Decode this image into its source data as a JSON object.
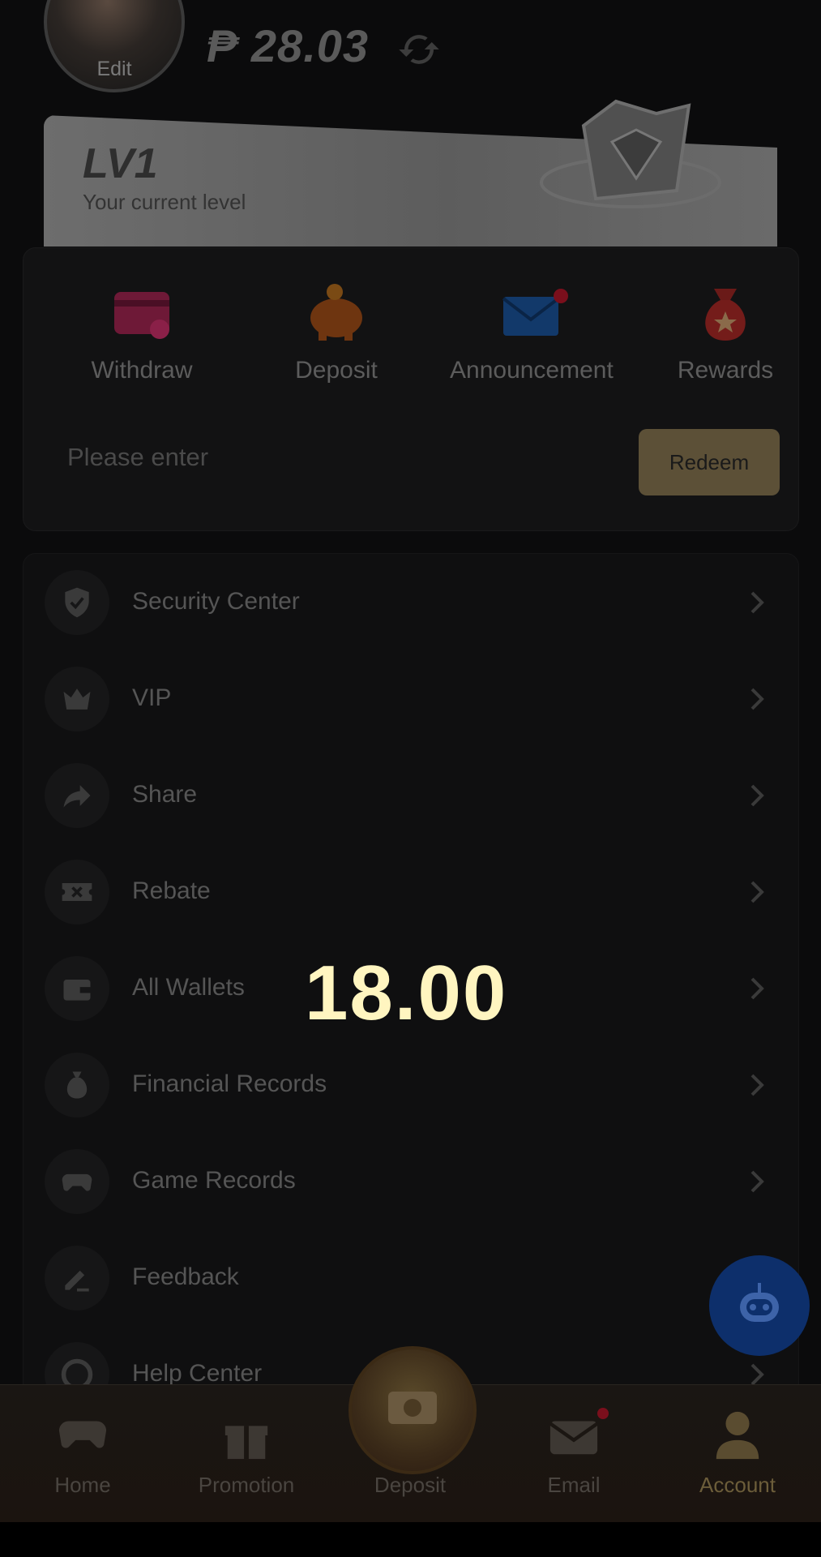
{
  "header": {
    "avatar_edit": "Edit",
    "balance": "₱ 28.03"
  },
  "level": {
    "name": "LV1",
    "subtitle": "Your current level"
  },
  "actions": [
    {
      "label": "Withdraw",
      "icon": "wallet-card-icon",
      "color": "#7a1a3c"
    },
    {
      "label": "Deposit",
      "icon": "piggy-bank-icon",
      "color": "#7a3d12"
    },
    {
      "label": "Announcement",
      "icon": "envelope-icon",
      "color": "#143d6e",
      "has_badge": true
    },
    {
      "label": "Rewards",
      "icon": "money-bag-icon",
      "color": "#7a1e1a"
    }
  ],
  "redeem": {
    "placeholder": "Please enter",
    "button": "Redeem"
  },
  "menu": [
    {
      "label": "Security Center",
      "icon": "shield-icon"
    },
    {
      "label": "VIP",
      "icon": "crown-icon"
    },
    {
      "label": "Share",
      "icon": "share-icon"
    },
    {
      "label": "Rebate",
      "icon": "ticket-icon"
    },
    {
      "label": "All Wallets",
      "icon": "wallet-icon"
    },
    {
      "label": "Financial Records",
      "icon": "money-bag-icon"
    },
    {
      "label": "Game Records",
      "icon": "gamepad-icon"
    },
    {
      "label": "Feedback",
      "icon": "pencil-icon"
    },
    {
      "label": "Help Center",
      "icon": "help-icon"
    }
  ],
  "overlay_value": "18.00",
  "nav": [
    {
      "label": "Home",
      "icon": "gamepad-icon"
    },
    {
      "label": "Promotion",
      "icon": "gift-icon"
    },
    {
      "label": "Deposit",
      "icon": "deposit-coin-icon"
    },
    {
      "label": "Email",
      "icon": "envelope-icon",
      "has_badge": true
    },
    {
      "label": "Account",
      "icon": "user-icon",
      "active": true
    }
  ]
}
